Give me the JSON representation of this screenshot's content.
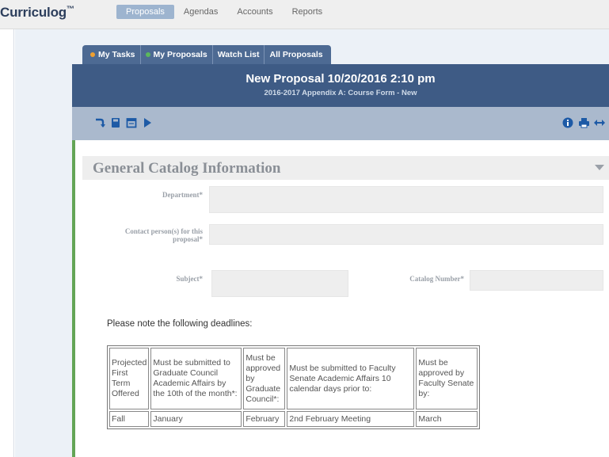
{
  "app": {
    "logo": "Curriculog",
    "logo_mark": "™"
  },
  "nav": [
    {
      "label": "Proposals",
      "active": true
    },
    {
      "label": "Agendas",
      "active": false
    },
    {
      "label": "Accounts",
      "active": false
    },
    {
      "label": "Reports",
      "active": false
    }
  ],
  "tabs": [
    {
      "label": "My Tasks",
      "dot_color": "#f0a030"
    },
    {
      "label": "My Proposals",
      "dot_color": "#5cb85c"
    },
    {
      "label": "Watch List",
      "dot_color": null
    },
    {
      "label": "All Proposals",
      "dot_color": null
    }
  ],
  "header": {
    "title": "New Proposal 10/20/2016 2:10 pm",
    "subtitle": "2016-2017 Appendix A: Course Form - New"
  },
  "toolbar": {
    "left_icons": [
      "hook-arrow-icon",
      "save-icon",
      "calendar-icon",
      "play-icon"
    ],
    "right_icons": [
      "info-icon",
      "print-icon",
      "expand-icon"
    ]
  },
  "section": {
    "title": "General Catalog Information",
    "fields": {
      "department": {
        "label": "Department*",
        "value": ""
      },
      "contact": {
        "label": "Contact person(s) for this proposal*",
        "value": ""
      },
      "subject": {
        "label": "Subject*",
        "value": ""
      },
      "catalog_number": {
        "label": "Catalog Number*",
        "value": ""
      }
    },
    "note": "Please note the following deadlines:"
  },
  "deadlines_table": {
    "headers": [
      "Projected First Term Offered",
      "Must be submitted to Graduate Council Academic Affairs by the 10th of the month*:",
      "Must be approved by Graduate Council*:",
      "Must be submitted to Faculty Senate Academic Affairs 10 calendar days prior to:",
      "Must be approved by Faculty Senate by:"
    ],
    "rows": [
      [
        "Fall",
        "January",
        "February",
        "2nd February Meeting",
        "March"
      ]
    ]
  },
  "colors": {
    "accent": "#3e5b85",
    "tab_bar": "#4d6a93",
    "toolbar": "#aab9cd",
    "left_border": "#63a556"
  }
}
